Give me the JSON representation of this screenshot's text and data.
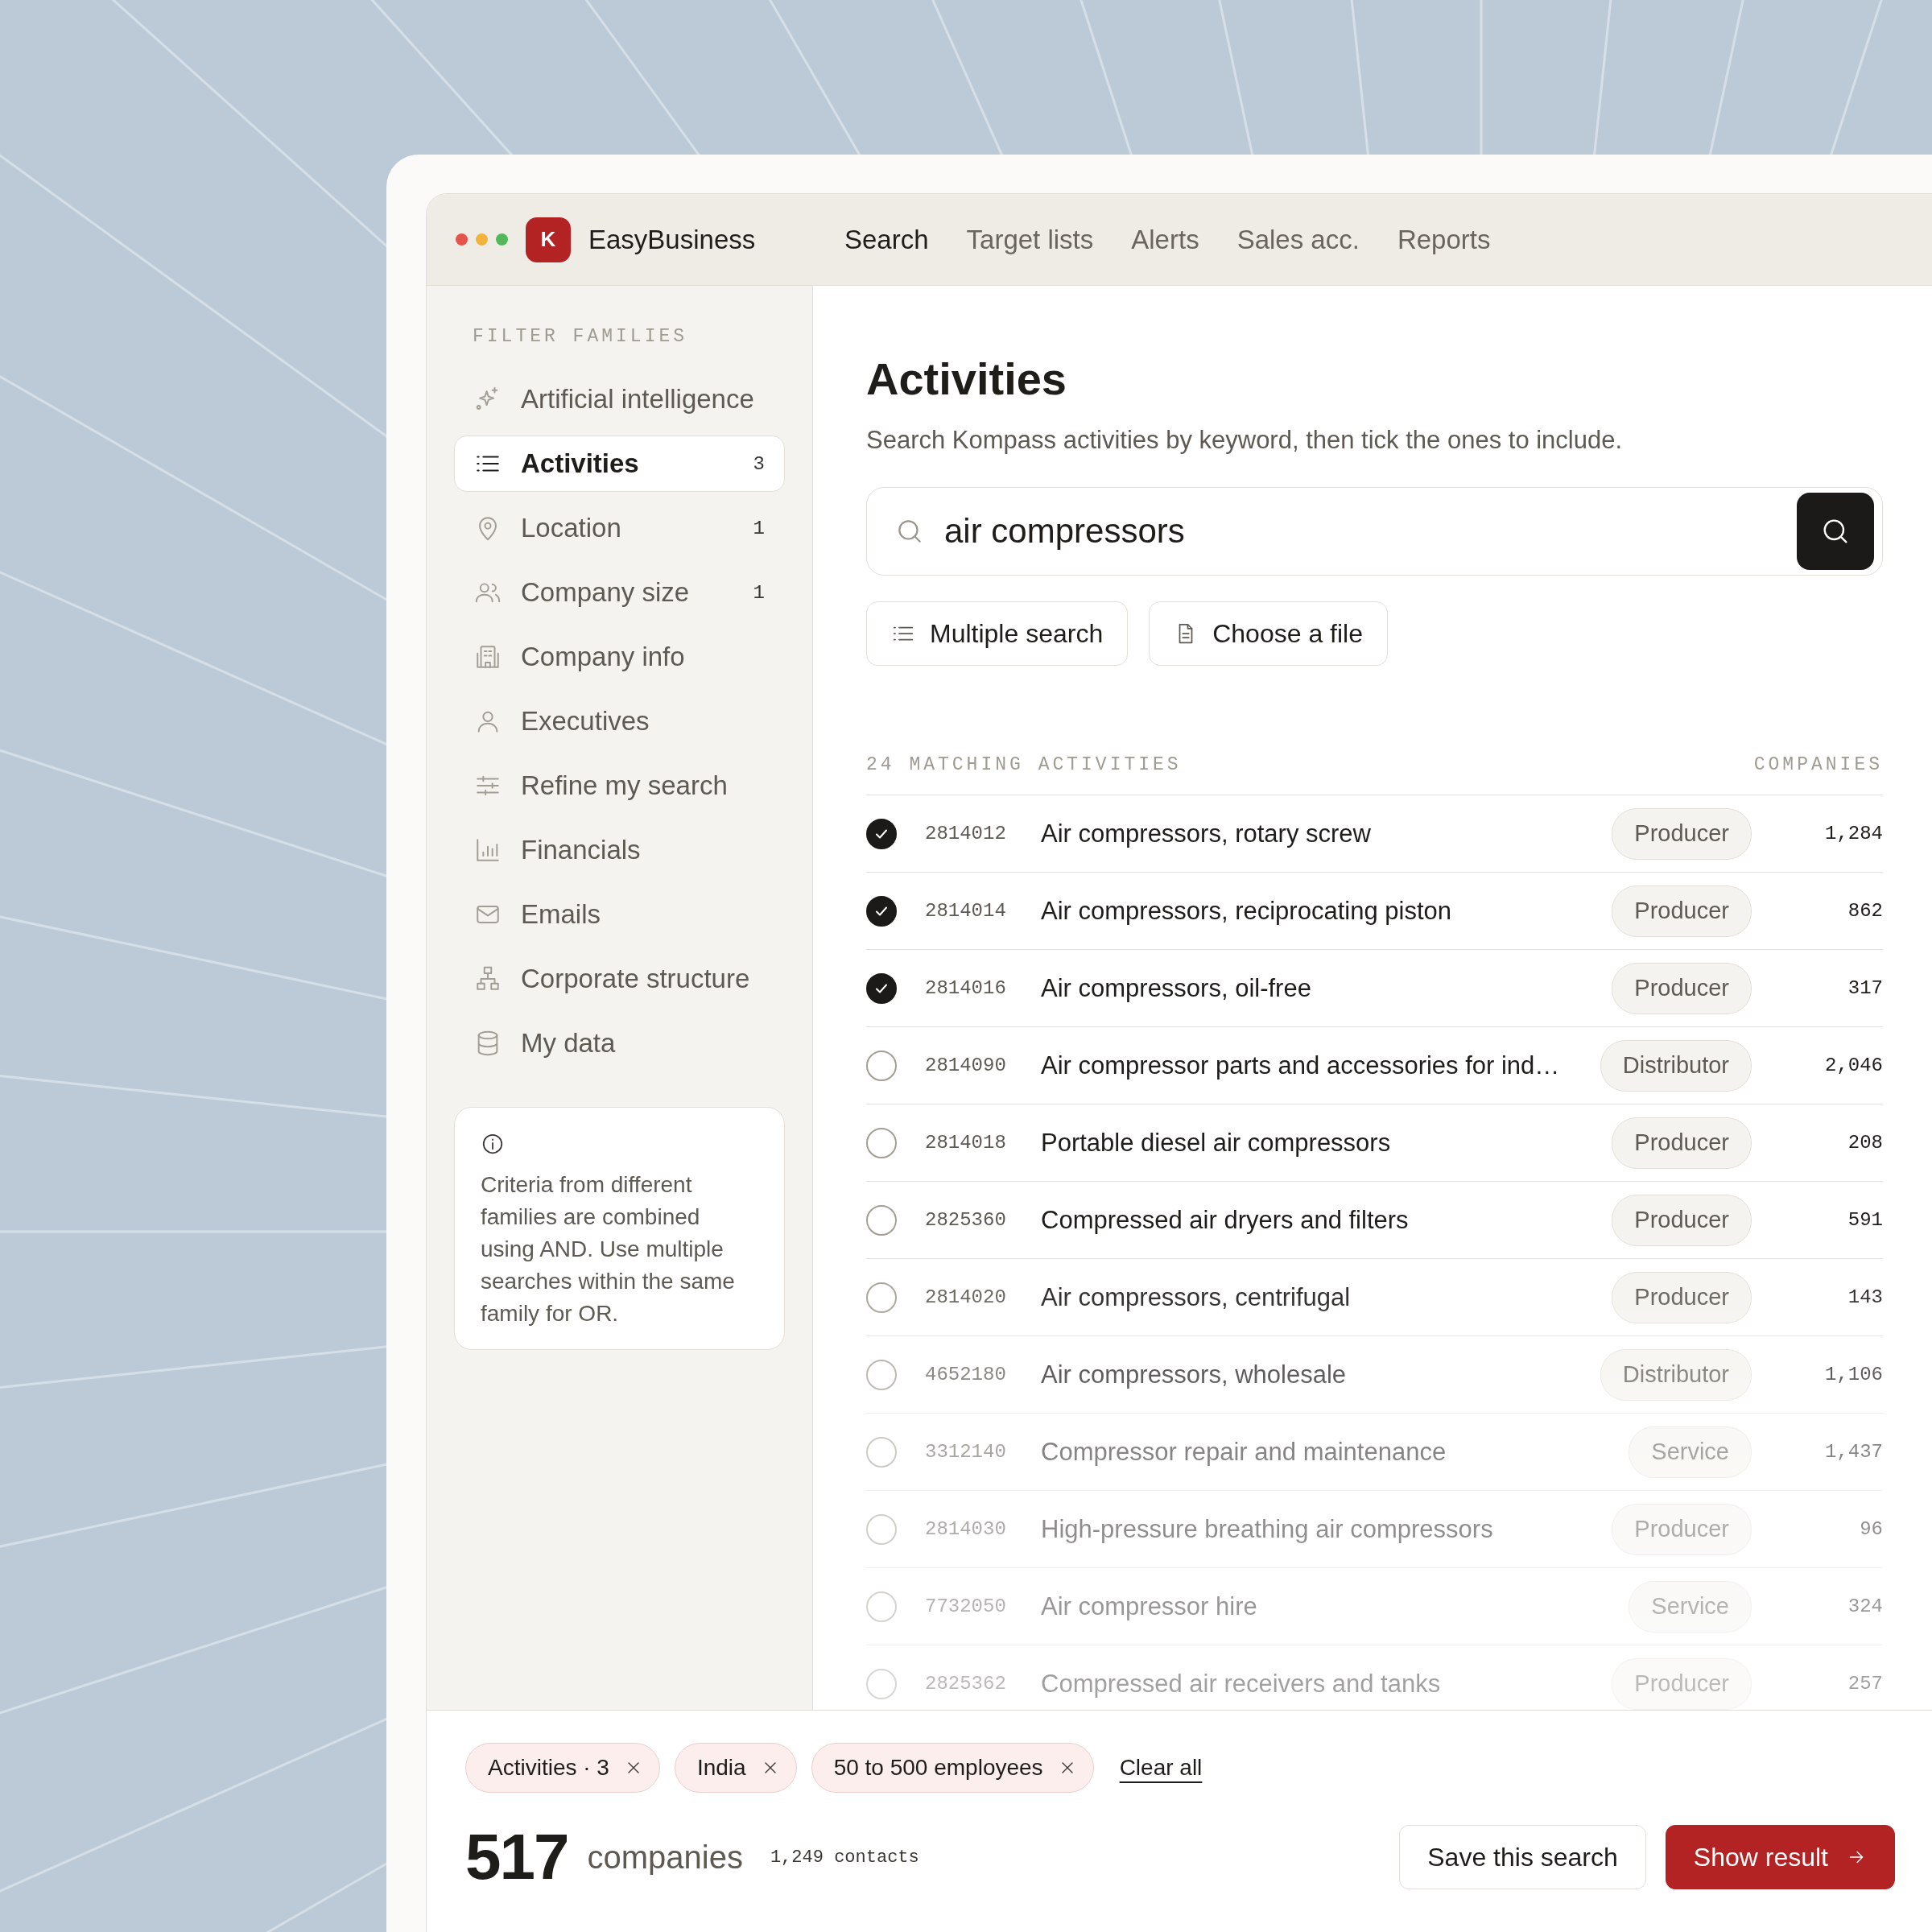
{
  "app": {
    "logo": "K",
    "name": "EasyBusiness"
  },
  "nav": [
    {
      "label": "Search",
      "selected": true
    },
    {
      "label": "Target lists",
      "selected": false
    },
    {
      "label": "Alerts",
      "selected": false
    },
    {
      "label": "Sales acc.",
      "selected": false
    },
    {
      "label": "Reports",
      "selected": false
    }
  ],
  "sidebar": {
    "heading": "FILTER FAMILIES",
    "items": [
      {
        "label": "Artificial intelligence",
        "selected": false
      },
      {
        "label": "Activities",
        "count": "3",
        "selected": true
      },
      {
        "label": "Location",
        "count": "1",
        "selected": false
      },
      {
        "label": "Company size",
        "count": "1",
        "selected": false
      },
      {
        "label": "Company info",
        "selected": false
      },
      {
        "label": "Executives",
        "selected": false
      },
      {
        "label": "Refine my search",
        "selected": false
      },
      {
        "label": "Financials",
        "selected": false
      },
      {
        "label": "Emails",
        "selected": false
      },
      {
        "label": "Corporate structure",
        "selected": false
      },
      {
        "label": "My data",
        "selected": false
      }
    ],
    "note": "Criteria from different families are combined using AND. Use multiple searches within the same family for OR."
  },
  "main": {
    "title": "Activities",
    "subtitle": "Search Kompass activities by keyword, then tick the ones to include.",
    "search": {
      "value": "air compressors"
    },
    "buttons": [
      {
        "label": "Multiple search"
      },
      {
        "label": "Choose a file"
      }
    ],
    "results": {
      "heading": "24 MATCHING ACTIVITIES",
      "column": "COMPANIES",
      "rows": [
        {
          "checked": true,
          "code": "2814012",
          "name": "Air compressors, rotary screw",
          "type": "Producer",
          "companies": "1,284"
        },
        {
          "checked": true,
          "code": "2814014",
          "name": "Air compressors, reciprocating piston",
          "type": "Producer",
          "companies": "862"
        },
        {
          "checked": true,
          "code": "2814016",
          "name": "Air compressors, oil-free",
          "type": "Producer",
          "companies": "317"
        },
        {
          "checked": false,
          "code": "2814090",
          "name": "Air compressor parts and accessories for ind…",
          "type": "Distributor",
          "companies": "2,046"
        },
        {
          "checked": false,
          "code": "2814018",
          "name": "Portable diesel air compressors",
          "type": "Producer",
          "companies": "208"
        },
        {
          "checked": false,
          "code": "2825360",
          "name": "Compressed air dryers and filters",
          "type": "Producer",
          "companies": "591"
        },
        {
          "checked": false,
          "code": "2814020",
          "name": "Air compressors, centrifugal",
          "type": "Producer",
          "companies": "143"
        },
        {
          "checked": false,
          "code": "4652180",
          "name": "Air compressors, wholesale",
          "type": "Distributor",
          "companies": "1,106"
        },
        {
          "checked": false,
          "code": "3312140",
          "name": "Compressor repair and maintenance",
          "type": "Service",
          "companies": "1,437"
        },
        {
          "checked": false,
          "code": "2814030",
          "name": "High-pressure breathing air compressors",
          "type": "Producer",
          "companies": "96"
        },
        {
          "checked": false,
          "code": "7732050",
          "name": "Air compressor hire",
          "type": "Service",
          "companies": "324"
        },
        {
          "checked": false,
          "code": "2825362",
          "name": "Compressed air receivers and tanks",
          "type": "Producer",
          "companies": "257"
        }
      ]
    }
  },
  "footer": {
    "chips": [
      {
        "label": "Activities · 3"
      },
      {
        "label": "India"
      },
      {
        "label": "50 to 500 employees"
      }
    ],
    "clear": "Clear all",
    "total": "517",
    "unit": "companies",
    "contacts": "1,249 contacts",
    "buttons": [
      {
        "label": "Save this search",
        "kind": "secondary"
      },
      {
        "label": "Show result",
        "kind": "primary"
      }
    ]
  }
}
